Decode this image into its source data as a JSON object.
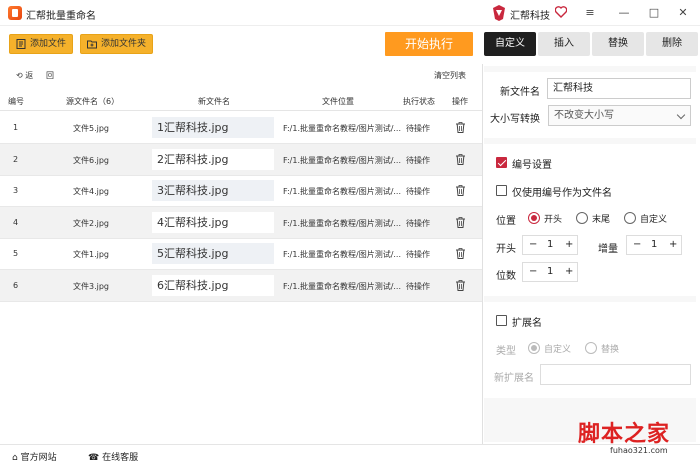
{
  "window": {
    "title": "汇帮批量重命名",
    "brand": "汇帮科技",
    "controls": [
      "≡",
      "—",
      "□",
      "✕"
    ]
  },
  "toolbar": {
    "add_file": "添加文件",
    "add_folder": "添加文件夹",
    "start": "开始执行"
  },
  "tabs": [
    {
      "label": "自定义",
      "active": true
    },
    {
      "label": "插入",
      "active": false
    },
    {
      "label": "替换",
      "active": false
    },
    {
      "label": "删除",
      "active": false
    }
  ],
  "subbar": {
    "undo": "返",
    "redo": "回",
    "clear": "清空列表"
  },
  "table": {
    "headers": [
      "编号",
      "源文件名（6）",
      "新文件名",
      "文件位置",
      "执行状态",
      "操作"
    ],
    "rows": [
      {
        "no": "1",
        "src": "文件5.jpg",
        "new": "1汇帮科技.jpg",
        "path": "F:/1.批量重命名教程/图片测试/...",
        "status": "待操作"
      },
      {
        "no": "2",
        "src": "文件6.jpg",
        "new": "2汇帮科技.jpg",
        "path": "F:/1.批量重命名教程/图片测试/...",
        "status": "待操作"
      },
      {
        "no": "3",
        "src": "文件4.jpg",
        "new": "3汇帮科技.jpg",
        "path": "F:/1.批量重命名教程/图片测试/...",
        "status": "待操作"
      },
      {
        "no": "4",
        "src": "文件2.jpg",
        "new": "4汇帮科技.jpg",
        "path": "F:/1.批量重命名教程/图片测试/...",
        "status": "待操作"
      },
      {
        "no": "5",
        "src": "文件1.jpg",
        "new": "5汇帮科技.jpg",
        "path": "F:/1.批量重命名教程/图片测试/...",
        "status": "待操作"
      },
      {
        "no": "6",
        "src": "文件3.jpg",
        "new": "6汇帮科技.jpg",
        "path": "F:/1.批量重命名教程/图片测试/...",
        "status": "待操作"
      }
    ]
  },
  "panel": {
    "new_name_label": "新文件名",
    "new_name_value": "汇帮科技",
    "case_label": "大小写转换",
    "case_value": "不改变大小写",
    "numbering_label": "编号设置",
    "numbering_checked": true,
    "only_number_label": "仅使用编号作为文件名",
    "only_number_checked": false,
    "position_label": "位置",
    "position_options": [
      "开头",
      "末尾",
      "自定义"
    ],
    "position_selected": "开头",
    "start_label": "开头",
    "start_value": "1",
    "increment_label": "增量",
    "increment_value": "1",
    "digits_label": "位数",
    "digits_value": "1",
    "stepper_minus": "−",
    "stepper_plus": "+",
    "ext_label": "扩展名",
    "ext_checked": false,
    "type_label": "类型",
    "type_options": [
      "自定义",
      "替换"
    ],
    "type_selected": "自定义",
    "new_ext_label": "新扩展名",
    "new_ext_value": ""
  },
  "footer": {
    "website": "官方网站",
    "service": "在线客服"
  },
  "watermark": {
    "text": "脚本之家",
    "sub": "fuhao321.com"
  },
  "colors": {
    "accent_orange": "#ff9a1f",
    "button_yellow": "#f5b12b",
    "accent_red": "#c9283e",
    "tab_active": "#1f1f1f"
  }
}
